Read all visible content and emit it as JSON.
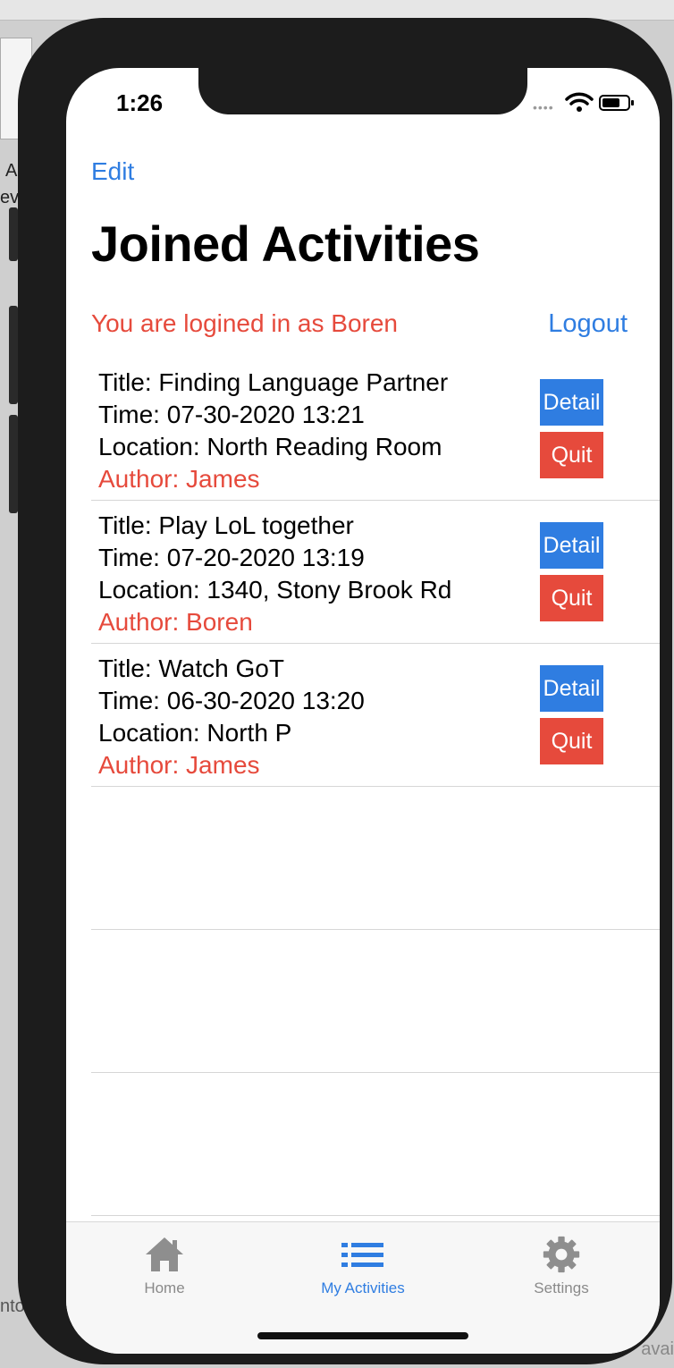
{
  "status_bar": {
    "time": "1:26",
    "signal": "••••"
  },
  "nav": {
    "edit_label": "Edit",
    "title": "Joined Activities"
  },
  "session": {
    "login_text": "You are logined in as Boren",
    "logout_label": "Logout"
  },
  "activities": [
    {
      "title": "Title: Finding Language Partner",
      "time": "Time: 07-30-2020 13:21",
      "location": "Location: North Reading Room",
      "author": "Author: James",
      "detail_label": "Detail",
      "quit_label": "Quit"
    },
    {
      "title": "Title: Play LoL together",
      "time": "Time: 07-20-2020 13:19",
      "location": "Location: 1340, Stony Brook Rd",
      "author": "Author: Boren",
      "detail_label": "Detail",
      "quit_label": "Quit"
    },
    {
      "title": "Title: Watch GoT",
      "time": "Time: 06-30-2020 13:20",
      "location": "Location: North P",
      "author": "Author: James",
      "detail_label": "Detail",
      "quit_label": "Quit"
    }
  ],
  "tabbar": {
    "tabs": [
      {
        "label": "Home",
        "icon": "house-icon",
        "active": false
      },
      {
        "label": "My Activities",
        "icon": "list-icon",
        "active": true
      },
      {
        "label": "Settings",
        "icon": "gear-icon",
        "active": false
      }
    ]
  },
  "background": {
    "left_text_1": "A",
    "left_text_2": "ev",
    "left_text_3": "nto",
    "right_text": "avai"
  },
  "colors": {
    "accent": "#2f7de1",
    "danger": "#e64a3c"
  }
}
